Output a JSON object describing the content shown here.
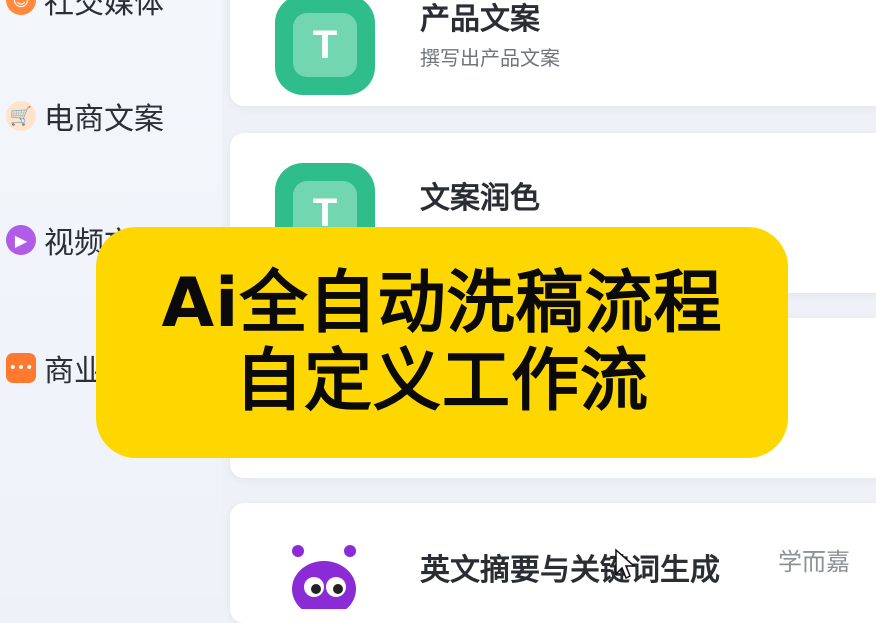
{
  "sidebar": {
    "items": [
      {
        "label": "社交媒体",
        "icon": "smile-icon",
        "color": "#ff8a3d"
      },
      {
        "label": "电商文案",
        "icon": "cart-icon",
        "color": "#ff7a2e"
      },
      {
        "label": "视频文案",
        "icon": "play-icon",
        "color": "#b05ce8"
      },
      {
        "label": "商业",
        "icon": "chat-icon",
        "color": "#ff7a2e"
      }
    ]
  },
  "cards": [
    {
      "title": "产品文案",
      "desc": "撰写出产品文案",
      "icon": "text-t-icon"
    },
    {
      "title": "文案润色",
      "desc": "",
      "icon": "text-t-icon"
    },
    {
      "title": "英文摘要与关键词生成",
      "desc": "",
      "icon": "monster-icon"
    }
  ],
  "banner": {
    "line1": "Ai全自动洗稿流程",
    "line2": "自定义工作流",
    "bg": "#ffd700"
  },
  "watermark": "学而嘉",
  "colors": {
    "accent_green": "#2ebd8b",
    "banner_yellow": "#ffd700",
    "monster_purple": "#8a2bd6"
  }
}
